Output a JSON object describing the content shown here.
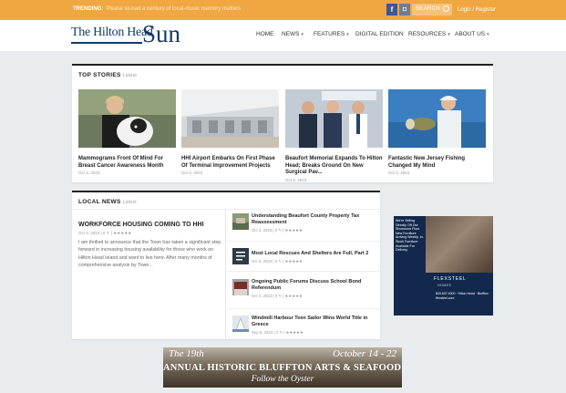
{
  "topbar": {
    "trending_label": "TRENDING:",
    "trending_text": "Please sit-had a century of local-music memory matters",
    "facebook_glyph": "f",
    "instagram_glyph": "◘",
    "search_placeholder": "SEARCH",
    "login_text": "Login / Register"
  },
  "logo": {
    "line1": "The Hilton Head",
    "line2": "Sun"
  },
  "nav": [
    {
      "label": "HOME",
      "dropdown": false
    },
    {
      "label": "NEWS",
      "dropdown": true
    },
    {
      "label": "FEATURES",
      "dropdown": true
    },
    {
      "label": "DIGITAL EDITION",
      "dropdown": false
    },
    {
      "label": "RESOURCES",
      "dropdown": true
    },
    {
      "label": "ABOUT US",
      "dropdown": true
    }
  ],
  "top_stories": {
    "heading": "TOP STORIES",
    "sub": "Latest",
    "stories": [
      {
        "title": "Mammograms Front Of Mind For Breast Cancer Awareness Month",
        "date": "Oct 3, 2023"
      },
      {
        "title": "HHI Airport Embarks On First Phase Of Terminal Improvement Projects",
        "date": "Oct 3, 2023"
      },
      {
        "title": "Beaufort Memorial Expands To Hilton Head; Breaks Ground On New Surgical Pav...",
        "date": "Oct 3, 2023"
      },
      {
        "title": "Fantastic New Jersey Fishing Changed My Mind",
        "date": "Oct 3, 2023"
      }
    ]
  },
  "local_news": {
    "heading": "LOCAL NEWS",
    "sub": "Latest",
    "featured": {
      "title": "WORKFORCE HOUSING COMING TO HHI",
      "meta": "Oct 3, 2023 | 0 ✎ | ★★★★★",
      "excerpt": "I am thrilled to announce that the Town has taken a significant step forward in increasing housing availability for those who work on Hilton Head Island and want to live here. After many months of comprehensive analysis by Town..."
    },
    "items": [
      {
        "title": "Understanding Beaufort County Property Tax Reassessment",
        "meta": "Oct 3, 2023 | 0 ✎ | ★★★★★"
      },
      {
        "title": "Most Local Rescues And Shelters Are Full, Part 2",
        "meta": "Oct 3, 2023 | 0 ✎ | ★★★★★"
      },
      {
        "title": "Ongoing Public Forums Discuss School Bond Referendum",
        "meta": "Oct 3, 2023 | 0 ✎ | ★★★★★"
      },
      {
        "title": "Windmill Harbour Teen Sailor Wins World Title in Greece",
        "meta": "Sep 6, 2023 | 0 ✎ | ★★★★★"
      }
    ]
  },
  "ads": {
    "side": {
      "text": "We're Selling Directly Off Our Showroom Floor. New Furniture Arriving Weekly. In-Stock Furniture Available For Delivery.",
      "brand": "FLEXSTEEL",
      "brand_sub": "HOMES",
      "address": "843.837.4000 · Hilton Head · Bluffton · flexsteel.com"
    },
    "banner": {
      "line1": "The 19th",
      "line2": "October 14 - 22",
      "line3": "ANNUAL HISTORIC BLUFFTON ARTS & SEAFOOD FESTIVAL",
      "line4": "Follow the Oyster"
    }
  },
  "colors": {
    "topbar": "#f0a742",
    "brand_blue": "#123a6b",
    "background": "#e9ecef"
  }
}
